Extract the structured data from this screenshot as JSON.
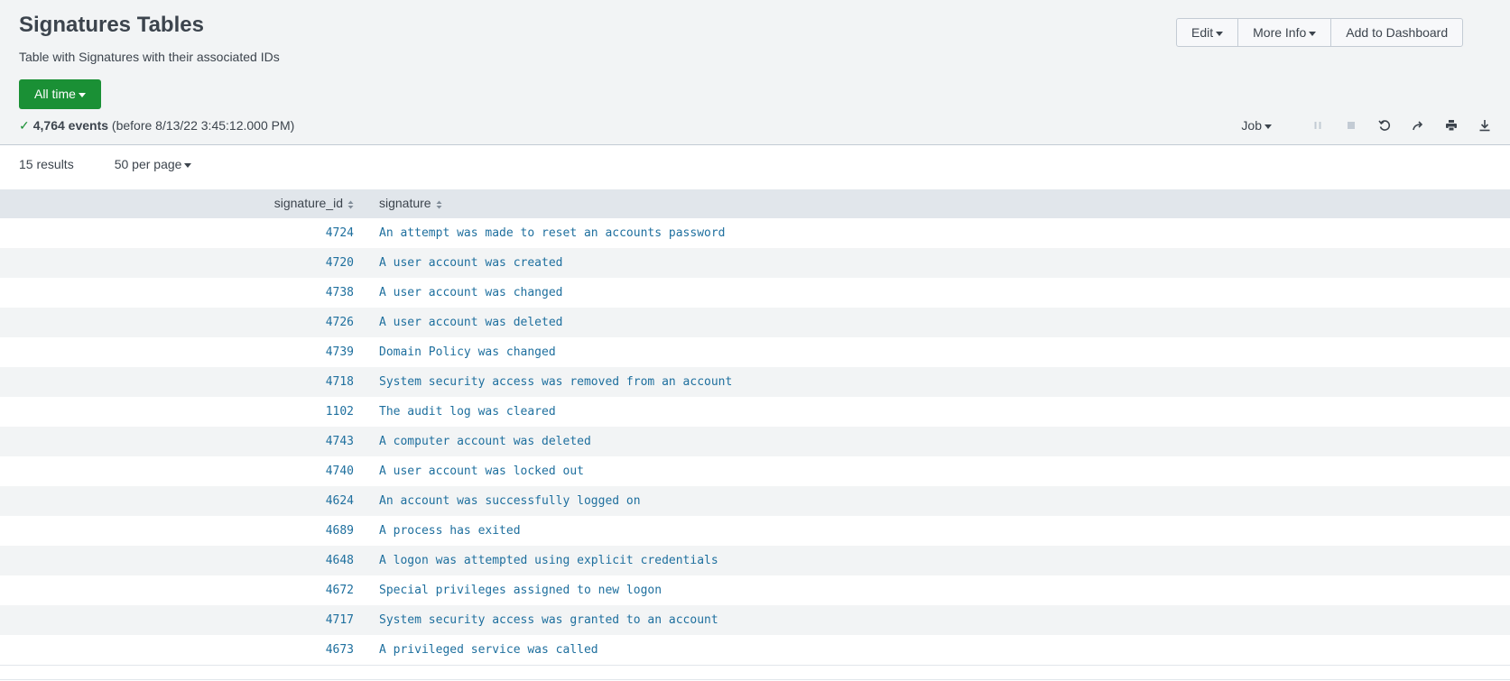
{
  "page": {
    "title": "Signatures Tables",
    "subtitle": "Table with Signatures with their associated IDs"
  },
  "actions": {
    "edit": "Edit",
    "more_info": "More Info",
    "add_to_dashboard": "Add to Dashboard"
  },
  "time_picker": {
    "label": "All time"
  },
  "search_status": {
    "check": "✓",
    "count": "4,764 events",
    "detail": "(before 8/13/22 3:45:12.000 PM)"
  },
  "job": {
    "label": "Job",
    "icons": [
      "pause-icon",
      "stop-icon",
      "refresh-icon",
      "share-icon",
      "print-icon",
      "export-icon"
    ]
  },
  "results": {
    "count": "15 results",
    "per_page": "50 per page"
  },
  "table": {
    "columns": [
      "signature_id",
      "signature"
    ],
    "rows": [
      {
        "id": "4724",
        "signature": "An attempt was made to reset an accounts password"
      },
      {
        "id": "4720",
        "signature": "A user account was created"
      },
      {
        "id": "4738",
        "signature": "A user account was changed"
      },
      {
        "id": "4726",
        "signature": "A user account was deleted"
      },
      {
        "id": "4739",
        "signature": "Domain Policy was changed"
      },
      {
        "id": "4718",
        "signature": "System security access was removed from an account"
      },
      {
        "id": "1102",
        "signature": "The audit log was cleared"
      },
      {
        "id": "4743",
        "signature": "A computer account was deleted"
      },
      {
        "id": "4740",
        "signature": "A user account was locked out"
      },
      {
        "id": "4624",
        "signature": "An account was successfully logged on"
      },
      {
        "id": "4689",
        "signature": "A process has exited"
      },
      {
        "id": "4648",
        "signature": "A logon was attempted using explicit credentials"
      },
      {
        "id": "4672",
        "signature": "Special privileges assigned to new logon"
      },
      {
        "id": "4717",
        "signature": "System security access was granted to an account"
      },
      {
        "id": "4673",
        "signature": "A privileged service was called"
      }
    ]
  },
  "colors": {
    "accent_green": "#1a9035",
    "link_blue": "#1e6f9e",
    "header_bg": "#f2f4f5"
  }
}
